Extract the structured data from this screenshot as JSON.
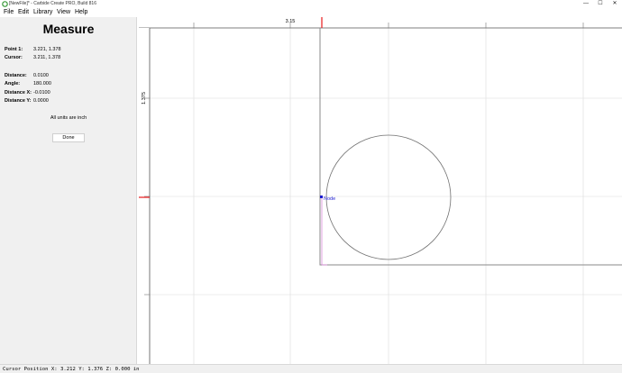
{
  "window": {
    "title": "[NewFile]* - Carbide Create PRO, Build 816",
    "minimize": "—",
    "maximize": "☐",
    "close": "✕"
  },
  "menu": {
    "items": [
      "File",
      "Edit",
      "Library",
      "View",
      "Help"
    ]
  },
  "measure": {
    "title": "Measure",
    "point1_label": "Point 1:",
    "point1_value": "3.221, 1.378",
    "cursor_label": "Cursor:",
    "cursor_value": "3.211, 1.378",
    "distance_label": "Distance:",
    "distance_value": "0.0100",
    "angle_label": "Angle:",
    "angle_value": "180.000",
    "dx_label": "Distance X:",
    "dx_value": "-0.0100",
    "dy_label": "Distance Y:",
    "dy_value": "0.0000",
    "units_note": "All units are inch",
    "done_label": "Done"
  },
  "canvas": {
    "ruler_top_label": "3.15",
    "ruler_left_label": "1.375",
    "node_label": "Node",
    "colors": {
      "marker": "#e8191c",
      "measure_line": "#d98ad9",
      "node": "#1a1ad0",
      "grid": "#dcdcdc",
      "shape": "#707070"
    }
  },
  "status": {
    "text": "Cursor Position X: 3.212 Y: 1.376 Z: 0.000 in"
  }
}
